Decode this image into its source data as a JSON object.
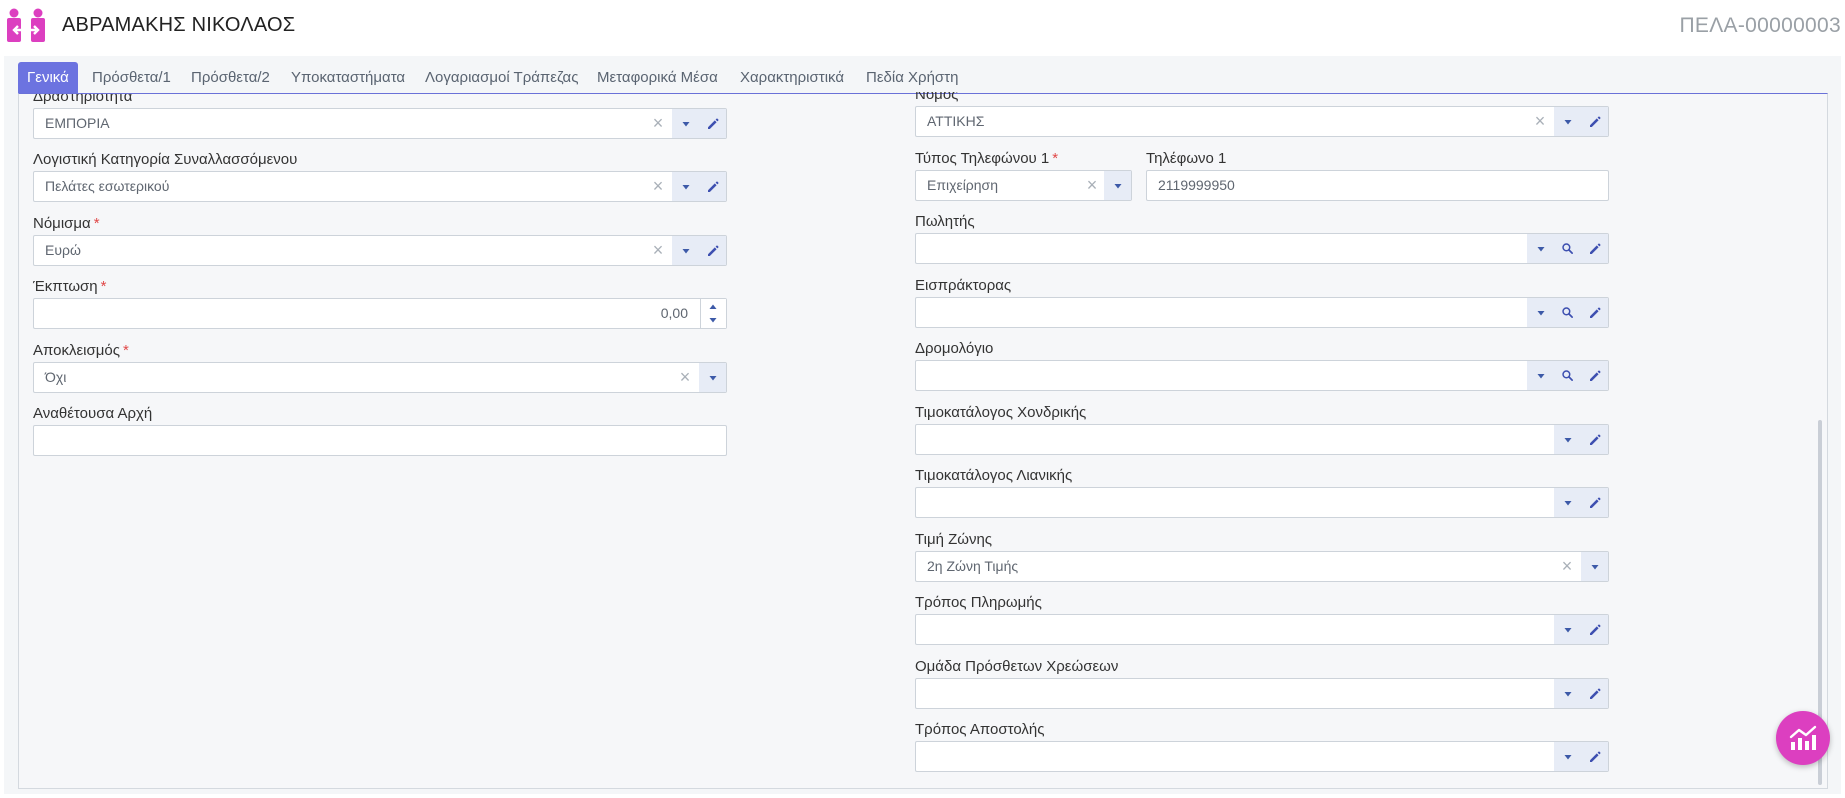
{
  "header": {
    "title": "ΑΒΡΑΜΑΚΗΣ ΝΙΚΟΛΑΟΣ",
    "code": "ΠΕΛΑ-00000003"
  },
  "tabs": [
    {
      "label": "Γενικά",
      "active": true
    },
    {
      "label": "Πρόσθετα/1"
    },
    {
      "label": "Πρόσθετα/2"
    },
    {
      "label": "Υποκαταστήματα"
    },
    {
      "label": "Λογαριασμοί Τράπεζας"
    },
    {
      "label": "Μεταφορικά Μέσα"
    },
    {
      "label": "Χαρακτηριστικά"
    },
    {
      "label": "Πεδία Χρήστη"
    }
  ],
  "left": {
    "activity": {
      "label": "Δραστηριότητα",
      "value": "ΕΜΠΟΡΙΑ"
    },
    "accounting_category": {
      "label": "Λογιστική Κατηγορία Συναλλασσόμενου",
      "value": "Πελάτες εσωτερικού"
    },
    "currency": {
      "label": "Νόμισμα",
      "required": "*",
      "value": "Ευρώ"
    },
    "discount": {
      "label": "Έκπτωση",
      "required": "*",
      "value": "0,00"
    },
    "exclusion": {
      "label": "Αποκλεισμός",
      "required": "*",
      "value": "Όχι"
    },
    "contracting_authority": {
      "label": "Αναθέτουσα Αρχή",
      "value": ""
    }
  },
  "right": {
    "prefecture": {
      "label": "Νομός",
      "value": "ΑΤΤΙΚΗΣ"
    },
    "phone_type": {
      "label": "Τύπος Τηλεφώνου 1",
      "required": "*",
      "value": "Επιχείρηση"
    },
    "phone": {
      "label": "Τηλέφωνο 1",
      "value": "2119999950"
    },
    "salesman": {
      "label": "Πωλητής",
      "value": ""
    },
    "collector": {
      "label": "Εισπράκτορας",
      "value": ""
    },
    "route": {
      "label": "Δρομολόγιο",
      "value": ""
    },
    "wholesale_pricelist": {
      "label": "Τιμοκατάλογος Χονδρικής",
      "value": ""
    },
    "retail_pricelist": {
      "label": "Τιμοκατάλογος Λιανικής",
      "value": ""
    },
    "zone_price": {
      "label": "Τιμή Ζώνης",
      "value": "2η Ζώνη Τιμής"
    },
    "payment_method": {
      "label": "Τρόπος Πληρωμής",
      "value": ""
    },
    "extra_charges_group": {
      "label": "Ομάδα Πρόσθετων Χρεώσεων",
      "value": ""
    },
    "shipping_method": {
      "label": "Τρόπος Αποστολής",
      "value": ""
    }
  },
  "icons": {
    "clear": "×",
    "dropdown": "chevron-down-icon",
    "edit": "pencil-icon",
    "search": "search-icon",
    "fab": "chart-icon"
  },
  "colors": {
    "accent": "#6c73e0",
    "brand": "#dc3fc0",
    "required": "#e04848"
  }
}
